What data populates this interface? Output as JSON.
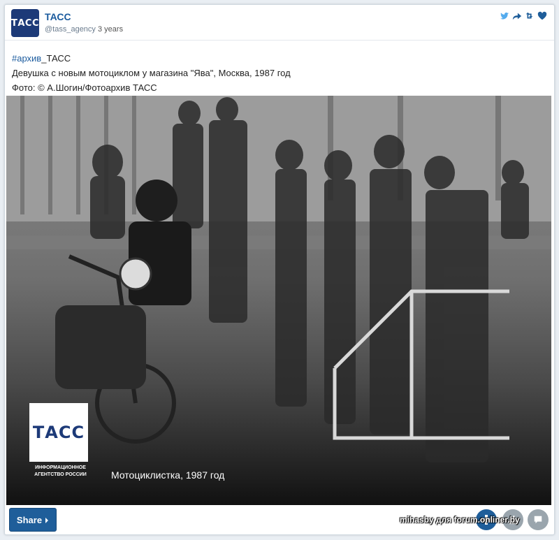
{
  "post": {
    "author": "ТАСС",
    "avatar_text": "ТАСС",
    "handle": "@tass_agency",
    "age": "3 years",
    "hashtag": "#архив",
    "hashtag_suffix": "_ТАСС",
    "line2": "Девушка с новым мотоциклом у магазина \"Ява\", Москва, 1987 год",
    "line3": "Фото: © А.Шогин/Фотоархив ТАСС"
  },
  "photo": {
    "logo_text": "ТАСС",
    "agency_line1": "ИНФОРМАЦИОННОЕ",
    "agency_line2": "АГЕНТСТВО РОССИИ",
    "caption": "Мотоциклистка, 1987 год"
  },
  "footer": {
    "share_label": "Share",
    "watermark": "mihasby для forum.onliner.by"
  },
  "icons": {
    "header": [
      "twitter-icon",
      "reply-icon",
      "retweet-icon",
      "heart-icon"
    ],
    "footer": [
      "plus-icon",
      "thumbs-up-icon",
      "comment-icon"
    ]
  },
  "colors": {
    "brand": "#1d3a78",
    "link": "#1b5b9e",
    "button": "#1f5e9a"
  }
}
